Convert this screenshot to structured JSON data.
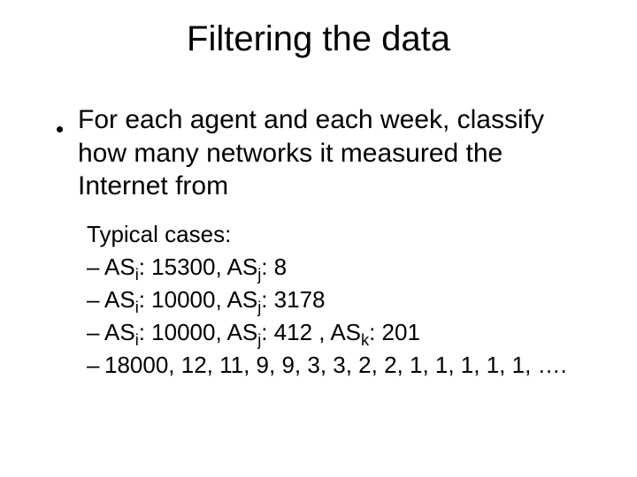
{
  "title": "Filtering the data",
  "main_bullet": "For each agent and each week, classify how many networks it measured the Internet from",
  "sub_heading": "Typical cases:",
  "cases": {
    "c1": {
      "asi": "AS",
      "asi_sub": "i",
      "asi_val": ": 15300, ",
      "asj": "AS",
      "asj_sub": "j",
      "asj_val": ": 8"
    },
    "c2": {
      "asi": "AS",
      "asi_sub": "i",
      "asi_val": ": 10000, ",
      "asj": "AS",
      "asj_sub": "j",
      "asj_val": ": 3178"
    },
    "c3": {
      "asi": "AS",
      "asi_sub": "i",
      "asi_val": ": 10000, ",
      "asj": "AS",
      "asj_sub": "j",
      "asj_val": ": 412 , ",
      "ask": "AS",
      "ask_sub": "k",
      "ask_val": ": 201"
    },
    "c4": "18000, 12, 11, 9, 9, 3, 3, 2, 2, 1, 1, 1, 1, 1, …."
  },
  "dash": "–"
}
